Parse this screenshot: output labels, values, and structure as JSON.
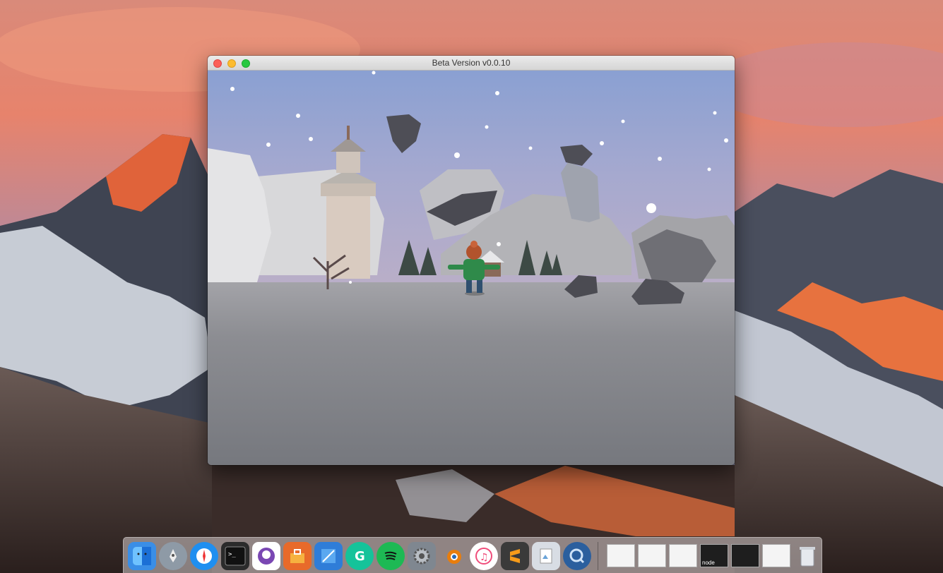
{
  "window": {
    "title": "Beta Version v0.0.10"
  },
  "dock": {
    "apps": [
      {
        "name": "Finder",
        "icon": "finder-icon",
        "color": "#3a8ee6"
      },
      {
        "name": "Launchpad",
        "icon": "rocket-icon",
        "color": "#8e9aa6"
      },
      {
        "name": "Safari",
        "icon": "compass-icon",
        "color": "#1f8ff0"
      },
      {
        "name": "Terminal",
        "icon": "terminal-icon",
        "color": "#2b2b2b"
      },
      {
        "name": "GitHub Desktop",
        "icon": "octocat-icon",
        "color": "#7a47b3"
      },
      {
        "name": "Toolbox",
        "icon": "toolbox-icon",
        "color": "#e86a2a"
      },
      {
        "name": "Xcode",
        "icon": "hammer-icon",
        "color": "#2f7dd8"
      },
      {
        "name": "Grammarly",
        "icon": "grammarly-icon",
        "color": "#15c39a"
      },
      {
        "name": "Spotify",
        "icon": "spotify-icon",
        "color": "#1db954"
      },
      {
        "name": "System Preferences",
        "icon": "gear-icon",
        "color": "#7f8790"
      },
      {
        "name": "Blender",
        "icon": "blender-icon",
        "color": "#e87d0d"
      },
      {
        "name": "iTunes",
        "icon": "music-icon",
        "color": "#f04d7b"
      },
      {
        "name": "Sublime Text",
        "icon": "sublime-icon",
        "color": "#f79c1a"
      },
      {
        "name": "Preview",
        "icon": "preview-icon",
        "color": "#d8dde4"
      },
      {
        "name": "QuickTime Player",
        "icon": "quicktime-icon",
        "color": "#2b5f9e"
      }
    ],
    "minimized": [
      {
        "kind": "window-thumbnail",
        "label": ""
      },
      {
        "kind": "window-thumbnail",
        "label": ""
      },
      {
        "kind": "window-thumbnail",
        "label": ""
      },
      {
        "kind": "terminal-thumbnail",
        "label": "node"
      },
      {
        "kind": "terminal-thumbnail",
        "label": ""
      },
      {
        "kind": "window-thumbnail",
        "label": ""
      },
      {
        "kind": "trash",
        "label": ""
      }
    ]
  }
}
